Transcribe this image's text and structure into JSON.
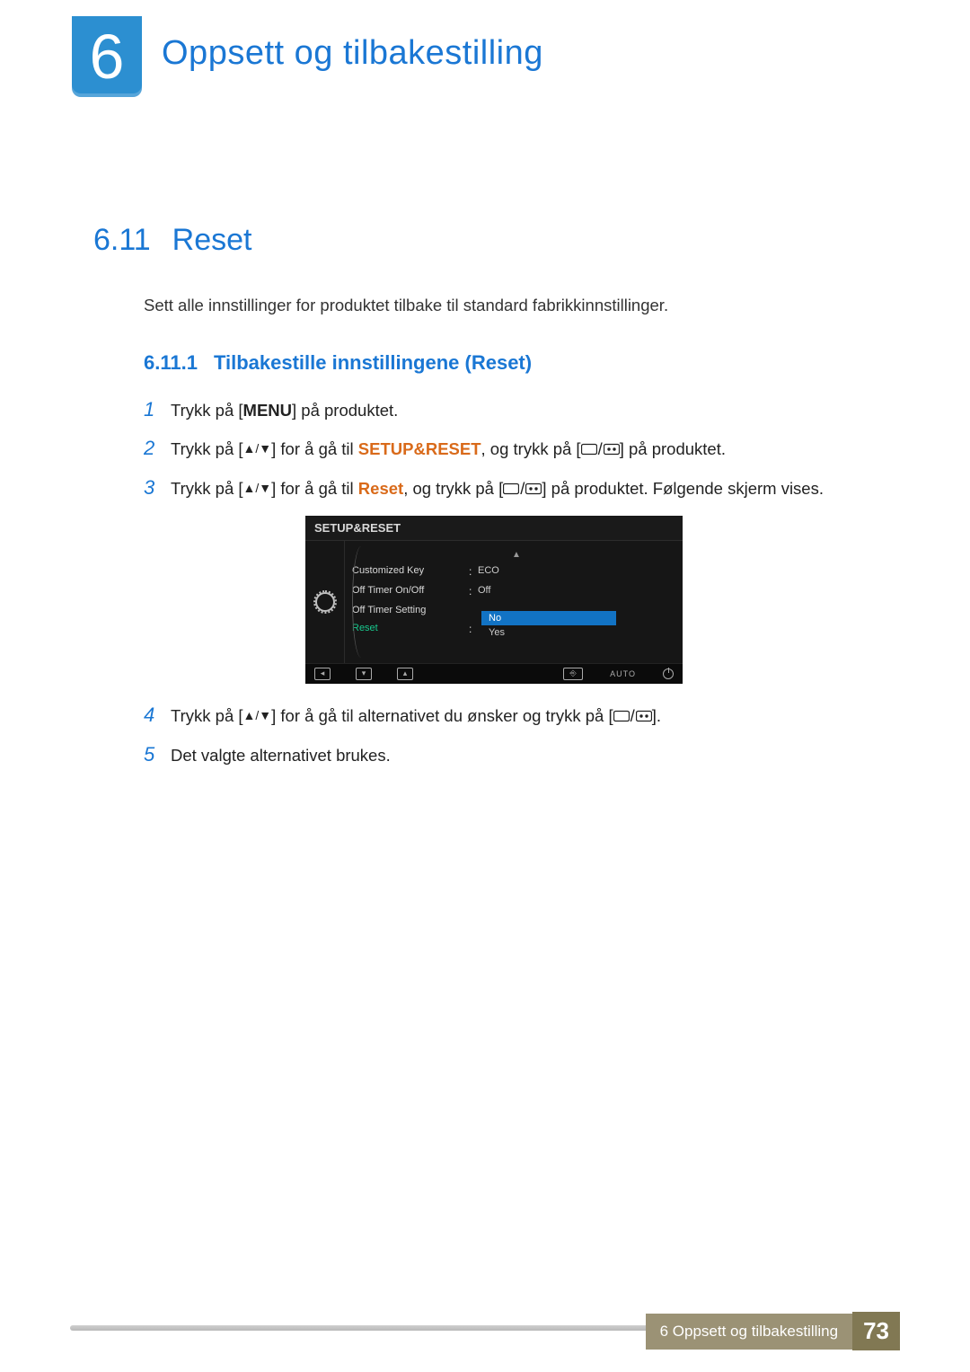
{
  "chapter": {
    "number": "6",
    "title": "Oppsett og tilbakestilling"
  },
  "section": {
    "number": "6.11",
    "title": "Reset",
    "description": "Sett alle innstillinger for produktet tilbake til standard fabrikkinnstillinger."
  },
  "subsection": {
    "number": "6.11.1",
    "title": "Tilbakestille innstillingene (Reset)"
  },
  "steps": {
    "s1": {
      "num": "1",
      "pre": "Trykk på [",
      "menu": "MENU",
      "post": "] på produktet."
    },
    "s2": {
      "num": "2",
      "pre": "Trykk på [",
      "mid1": "] for å gå til ",
      "target": "SETUP&RESET",
      "mid2": ", og trykk på [",
      "post": "] på produktet."
    },
    "s3": {
      "num": "3",
      "pre": "Trykk på [",
      "mid1": "] for å gå til ",
      "target": "Reset",
      "mid2": ", og trykk på [",
      "post": "] på produktet. Følgende skjerm vises."
    },
    "s4": {
      "num": "4",
      "pre": "Trykk på [",
      "mid1": "] for å gå til alternativet du ønsker og trykk på [",
      "post": "]."
    },
    "s5": {
      "num": "5",
      "text": "Det valgte alternativet brukes."
    }
  },
  "osd": {
    "title": "SETUP&RESET",
    "items": [
      {
        "label": "Customized Key",
        "value": "ECO"
      },
      {
        "label": "Off Timer On/Off",
        "value": "Off"
      },
      {
        "label": "Off Timer Setting",
        "value": ""
      },
      {
        "label": "Reset",
        "value": "",
        "is_reset": true
      }
    ],
    "popup": {
      "options": [
        "No",
        "Yes"
      ],
      "selected": "No"
    },
    "auto_label": "AUTO"
  },
  "footer": {
    "text": "6 Oppsett og tilbakestilling",
    "page": "73"
  }
}
